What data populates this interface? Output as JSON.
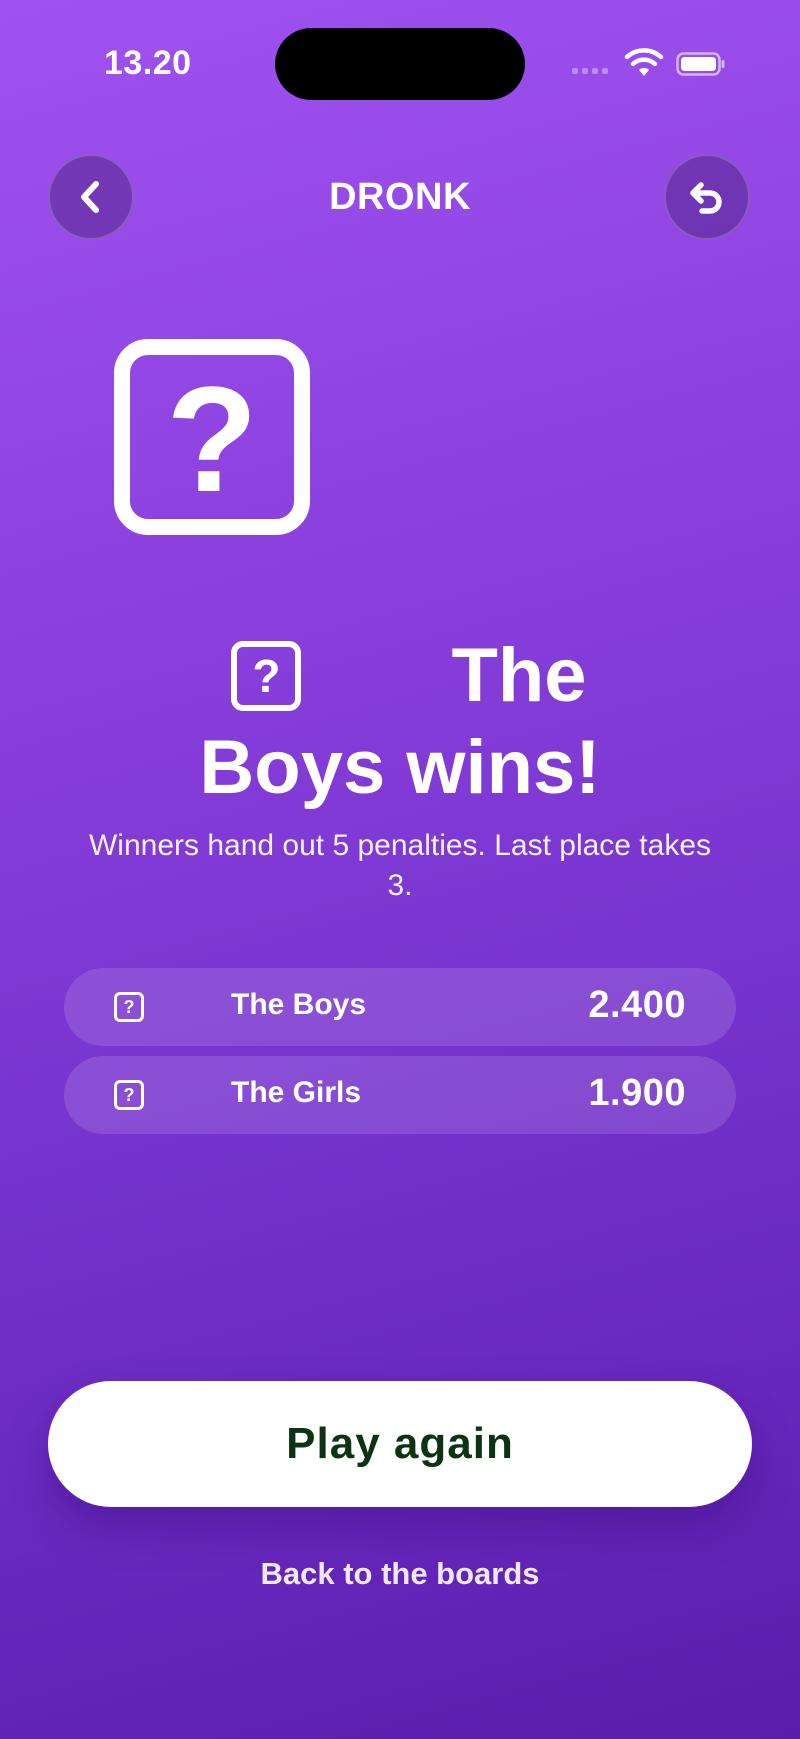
{
  "status_bar": {
    "time": "13.20"
  },
  "header": {
    "title": "DRONK",
    "back_icon": "chevron-left-icon",
    "undo_icon": "undo-icon"
  },
  "result": {
    "icon_glyph": "?",
    "headline_line1": "The",
    "headline_line2": "Boys wins!",
    "subtitle": "Winners hand out 5 penalties. Last place takes 3."
  },
  "scores": [
    {
      "icon_glyph": "?",
      "name": "The Boys",
      "score": "2.400"
    },
    {
      "icon_glyph": "?",
      "name": "The Girls",
      "score": "1.900"
    }
  ],
  "actions": {
    "play_again_label": "Play again",
    "back_to_boards_label": "Back to the boards"
  },
  "colors": {
    "background_top": "#a052f1",
    "background_bottom": "#5b1cad",
    "button_text": "#0c3314"
  }
}
